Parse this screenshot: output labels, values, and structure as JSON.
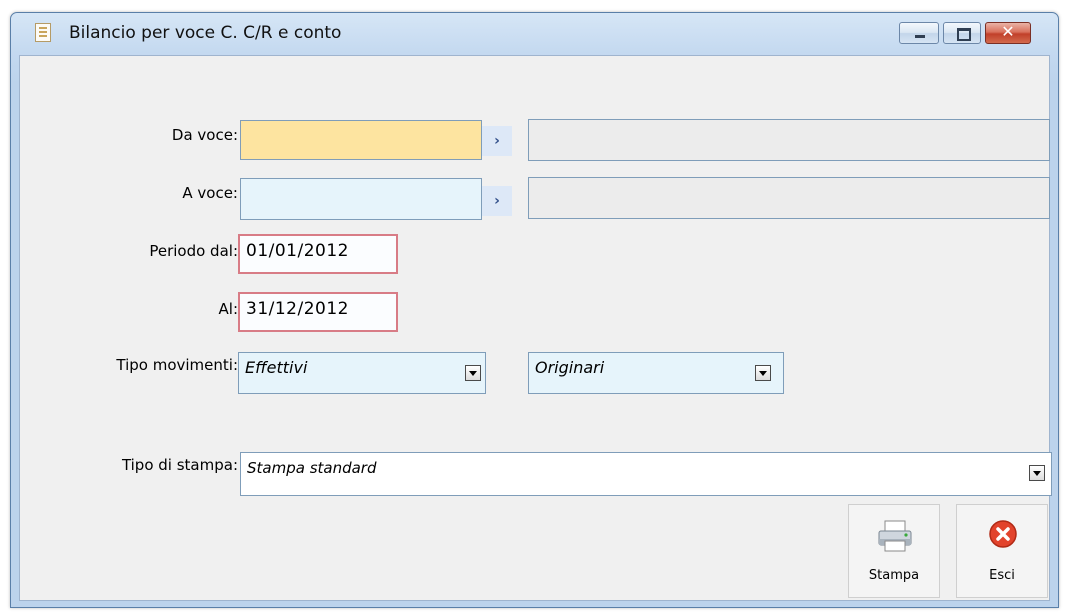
{
  "window": {
    "title": "Bilancio per voce C. C/R e conto",
    "close_glyph": "✕"
  },
  "form": {
    "da_voce": {
      "label": "Da voce:",
      "value": "",
      "description": ""
    },
    "a_voce": {
      "label": "A voce:",
      "value": "",
      "description": ""
    },
    "lookup_icon": "›",
    "periodo_dal": {
      "label": "Periodo dal:",
      "value": "01/01/2012"
    },
    "al": {
      "label": "Al:",
      "value": "31/12/2012"
    },
    "tipo_movimenti": {
      "label": "Tipo movimenti:",
      "value1": "Effettivi",
      "value2": "Originari"
    },
    "tipo_stampa": {
      "label": "Tipo di stampa:",
      "value": "Stampa standard"
    }
  },
  "buttons": {
    "stampa": "Stampa",
    "esci": "Esci"
  },
  "colors": {
    "highlight_field": "#fde4a0",
    "field_lightblue": "#e6f4fb",
    "date_border": "#d87c86",
    "close_button": "#c1402a"
  }
}
